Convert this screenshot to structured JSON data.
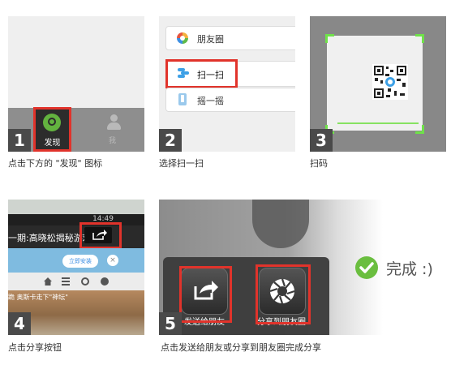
{
  "steps": [
    {
      "num": "1",
      "caption": "点击下方的 \"发现\" 图标",
      "tab_discover": "发现",
      "tab_me": "我",
      "icons": [
        "compass-icon",
        "person-icon"
      ]
    },
    {
      "num": "2",
      "caption": "选择扫一扫",
      "items": [
        "朋友圈",
        "扫一扫",
        "摇一摇"
      ],
      "icons": [
        "moments-icon",
        "scan-icon",
        "shake-icon"
      ]
    },
    {
      "num": "3",
      "caption": "扫码",
      "icons": [
        "qr-code"
      ]
    },
    {
      "num": "4",
      "caption": "点击分享按钮",
      "time": "14:49",
      "title": "一期:高晓松揭秘游戏",
      "follow": "立即安装",
      "photo_text": "跪 奥斯卡走下\"神坛\"",
      "icons": [
        "share-icon",
        "home-icon",
        "list-icon",
        "search-icon",
        "clock-icon"
      ]
    },
    {
      "num": "5",
      "caption": "点击发送给朋友或分享到朋友圈完成分享",
      "send_label": "发送给朋友",
      "moments_label": "分享到朋友圈",
      "done": "完成 :)",
      "icons": [
        "share-icon",
        "shutter-icon",
        "checkmark-icon"
      ]
    }
  ],
  "colors": {
    "highlight": "#e1332b",
    "badge": "#4a4a4a",
    "accent_green": "#6abe3f"
  }
}
